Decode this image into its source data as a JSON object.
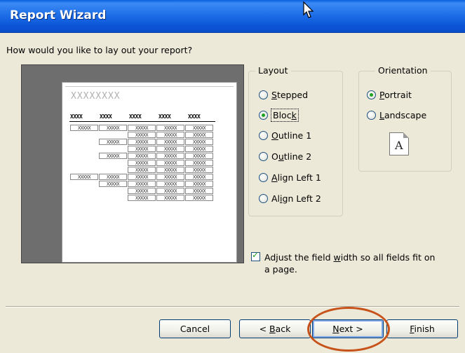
{
  "window": {
    "title": "Report Wizard"
  },
  "prompt": "How would you like to lay out your report?",
  "preview": {
    "title_placeholder": "XXXXXXXX",
    "header_cells": [
      "XXXX",
      "XXXX",
      "XXXX",
      "XXXX",
      "XXXX"
    ],
    "cell_text": "XXXXX"
  },
  "layout": {
    "legend": "Layout",
    "options": [
      {
        "pre": "",
        "key": "S",
        "post": "tepped",
        "selected": false
      },
      {
        "pre": "Bloc",
        "key": "k",
        "post": "",
        "selected": true
      },
      {
        "pre": "",
        "key": "O",
        "post": "utline 1",
        "selected": false
      },
      {
        "pre": "O",
        "key": "u",
        "post": "tline 2",
        "selected": false
      },
      {
        "pre": "",
        "key": "A",
        "post": "lign Left 1",
        "selected": false
      },
      {
        "pre": "Al",
        "key": "i",
        "post": "gn Left 2",
        "selected": false
      }
    ]
  },
  "orientation": {
    "legend": "Orientation",
    "options": [
      {
        "pre": "",
        "key": "P",
        "post": "ortrait",
        "selected": true
      },
      {
        "pre": "",
        "key": "L",
        "post": "andscape",
        "selected": false
      }
    ],
    "icon_letter": "A"
  },
  "adjust": {
    "pre": "Adjust the field ",
    "key": "w",
    "post": "idth so all fields fit on",
    "line2": "a page.",
    "checked": true
  },
  "buttons": {
    "cancel": "Cancel",
    "back": {
      "pre": "< ",
      "key": "B",
      "post": "ack"
    },
    "next": {
      "pre": "",
      "key": "N",
      "post": "ext >"
    },
    "finish": {
      "pre": "",
      "key": "F",
      "post": "inish"
    }
  },
  "colors": {
    "titlebar": "#0b55d8",
    "dialog": "#ece9d8",
    "annotation": "#c8531a"
  }
}
